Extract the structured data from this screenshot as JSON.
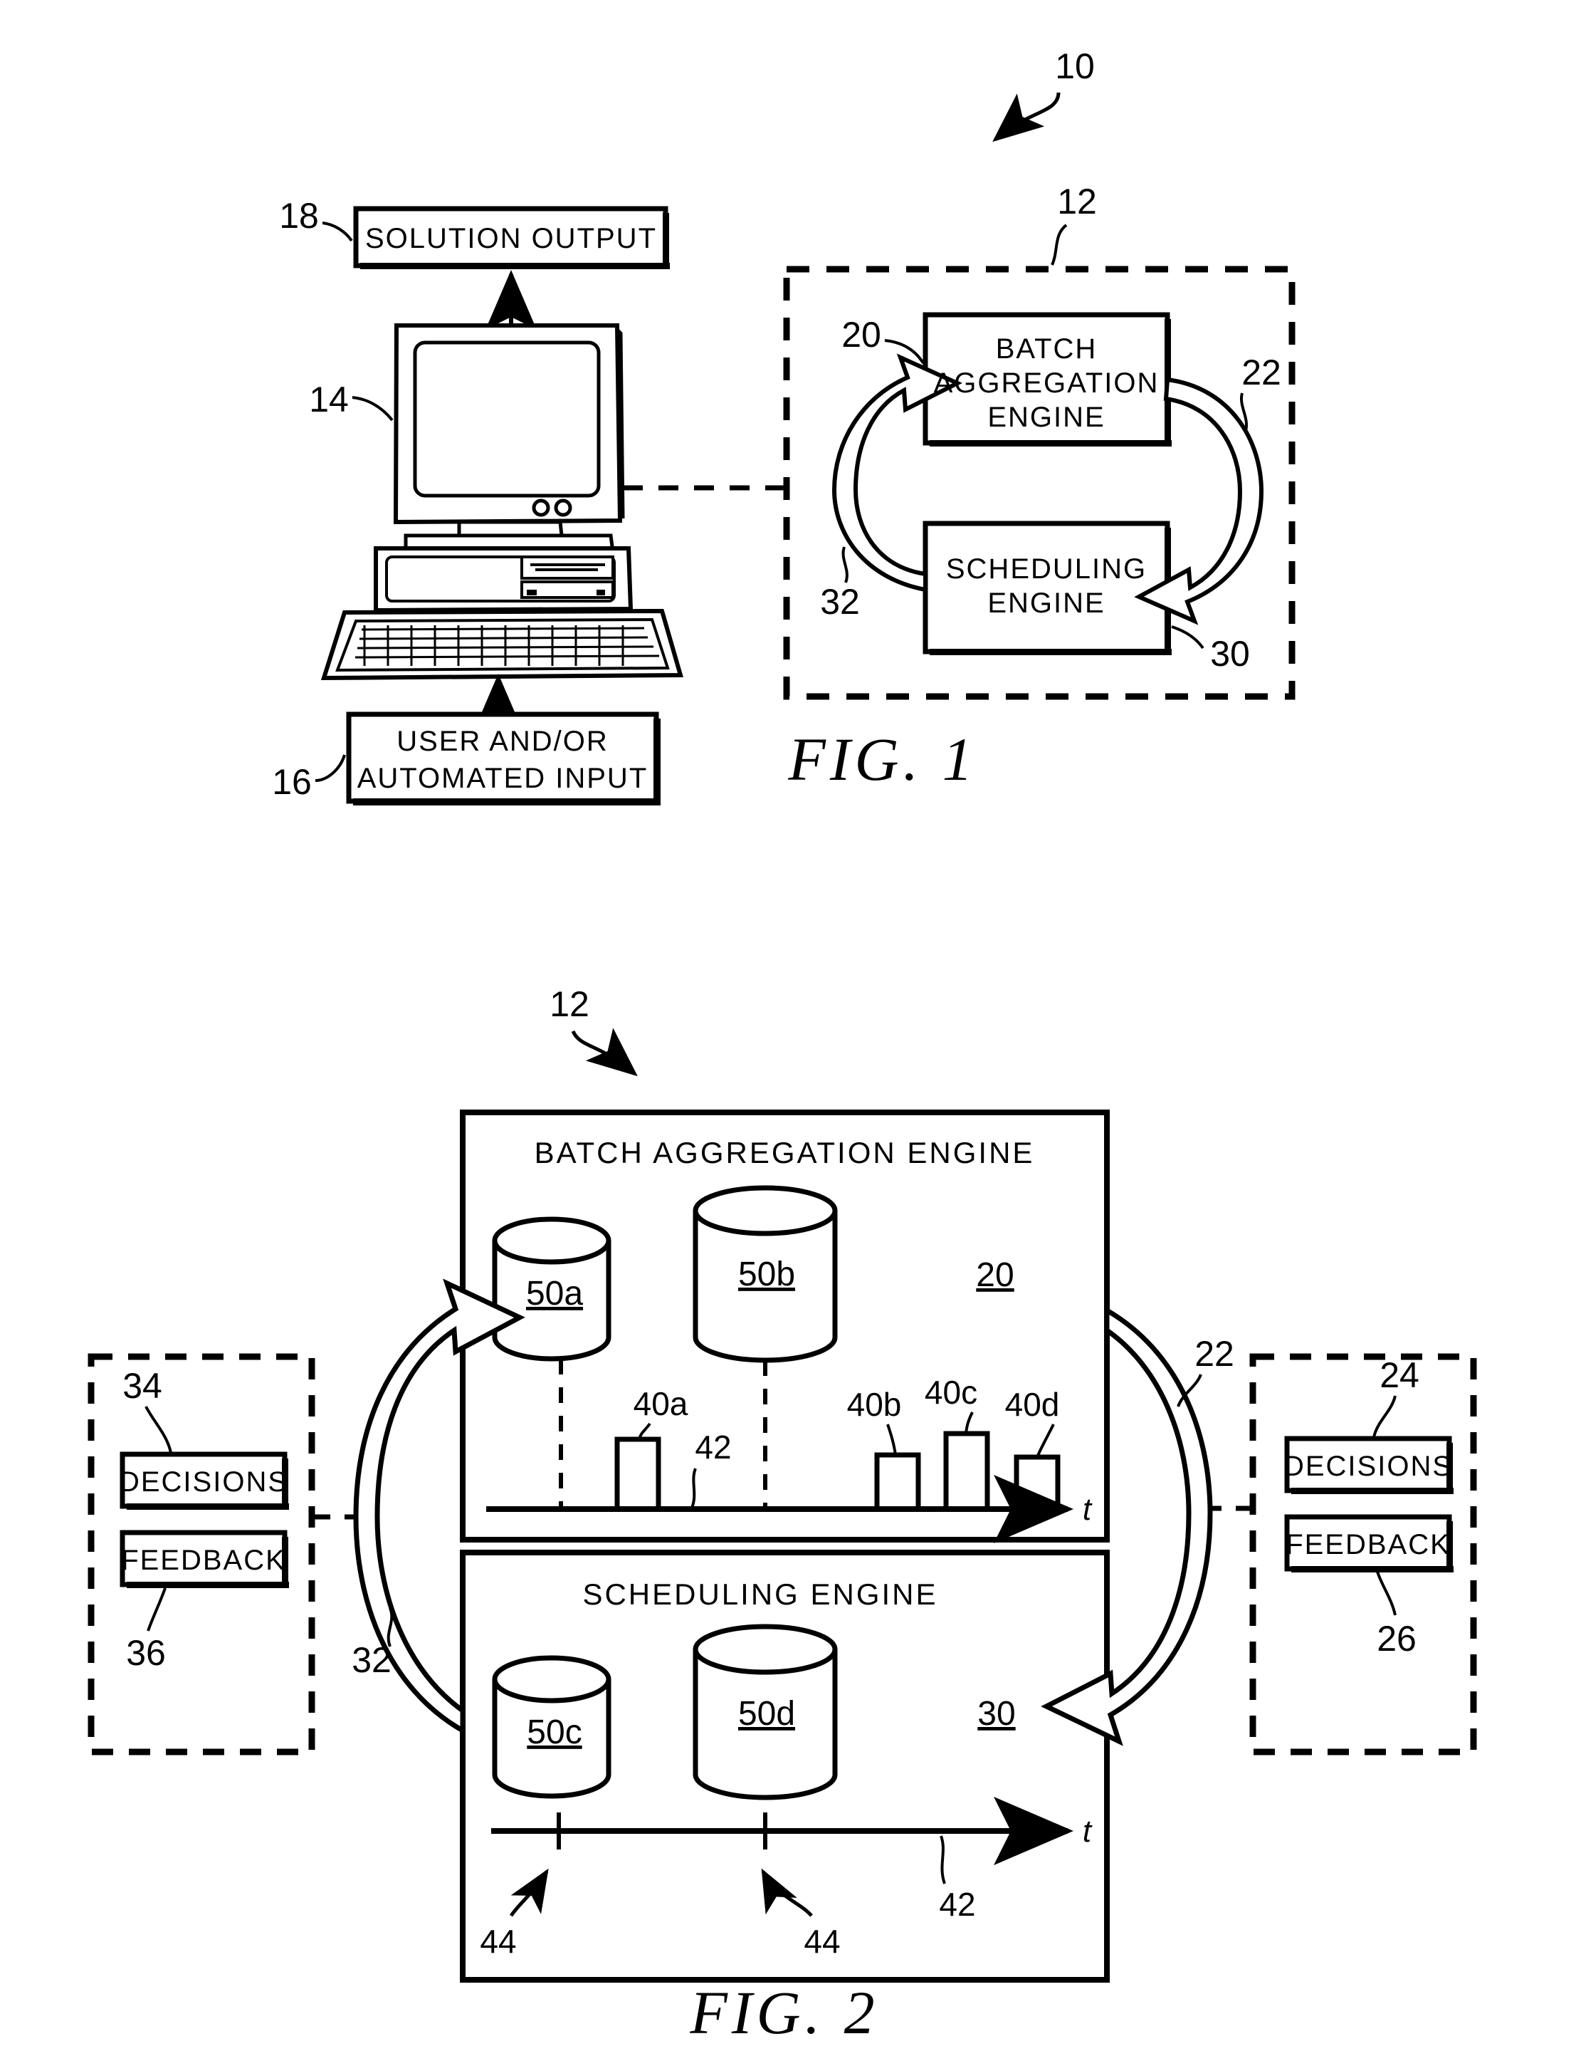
{
  "document": {
    "type": "patent-figure-sheet",
    "figures": [
      "FIG. 1",
      "FIG. 2"
    ]
  },
  "fig1": {
    "caption": "FIG.  1",
    "system_ref": "10",
    "solution_output": {
      "label": "SOLUTION  OUTPUT",
      "ref": "18"
    },
    "computer": {
      "ref": "14"
    },
    "user_input": {
      "line1": "USER AND/OR",
      "line2": "AUTOMATED INPUT",
      "ref": "16"
    },
    "container": {
      "ref": "12"
    },
    "batch_engine": {
      "line1": "BATCH",
      "line2": "AGGREGATION",
      "line3": "ENGINE",
      "ref": "20"
    },
    "scheduling_engine": {
      "line1": "SCHEDULING",
      "line2": "ENGINE",
      "ref": "30"
    },
    "arrow_down_ref": "22",
    "arrow_up_ref": "32"
  },
  "fig2": {
    "caption": "FIG.  2",
    "container_ref": "12",
    "batch_panel": {
      "title": "BATCH AGGREGATION ENGINE",
      "ref": "20",
      "cylinders": [
        {
          "label": "50a",
          "size": "small"
        },
        {
          "label": "50b",
          "size": "large"
        }
      ],
      "bars": [
        {
          "label": "40a"
        },
        {
          "label": "40b"
        },
        {
          "label": "40c"
        },
        {
          "label": "40d"
        }
      ],
      "axis_ref": "42",
      "axis_label": "t"
    },
    "scheduling_panel": {
      "title": "SCHEDULING ENGINE",
      "ref": "30",
      "cylinders": [
        {
          "label": "50c",
          "size": "small"
        },
        {
          "label": "50d",
          "size": "large"
        }
      ],
      "ticks": [
        {
          "label": "44"
        },
        {
          "label": "44"
        }
      ],
      "axis_ref": "42",
      "axis_label": "t"
    },
    "left_group": {
      "decisions": {
        "label": "DECISIONS",
        "ref": "34"
      },
      "feedback": {
        "label": "FEEDBACK",
        "ref": "36"
      }
    },
    "right_group": {
      "decisions": {
        "label": "DECISIONS",
        "ref": "24"
      },
      "feedback": {
        "label": "FEEDBACK",
        "ref": "26"
      }
    },
    "arrow_down_ref": "22",
    "arrow_up_ref": "32"
  },
  "chart_data": [
    {
      "type": "bar",
      "title": "BATCH AGGREGATION ENGINE",
      "xlabel": "t",
      "ylabel": "",
      "categories": [
        "40a",
        "40b",
        "40c",
        "40d"
      ],
      "values": [
        1.0,
        0.78,
        1.12,
        0.68
      ],
      "grid": false,
      "legend": "none",
      "annotations": [
        "50a",
        "50b",
        "20",
        "42"
      ]
    },
    {
      "type": "line",
      "title": "SCHEDULING ENGINE",
      "xlabel": "t",
      "ylabel": "",
      "categories": [
        "44",
        "44"
      ],
      "values": [
        0,
        0
      ],
      "grid": false,
      "legend": "none",
      "annotations": [
        "50c",
        "50d",
        "30",
        "42"
      ]
    }
  ]
}
